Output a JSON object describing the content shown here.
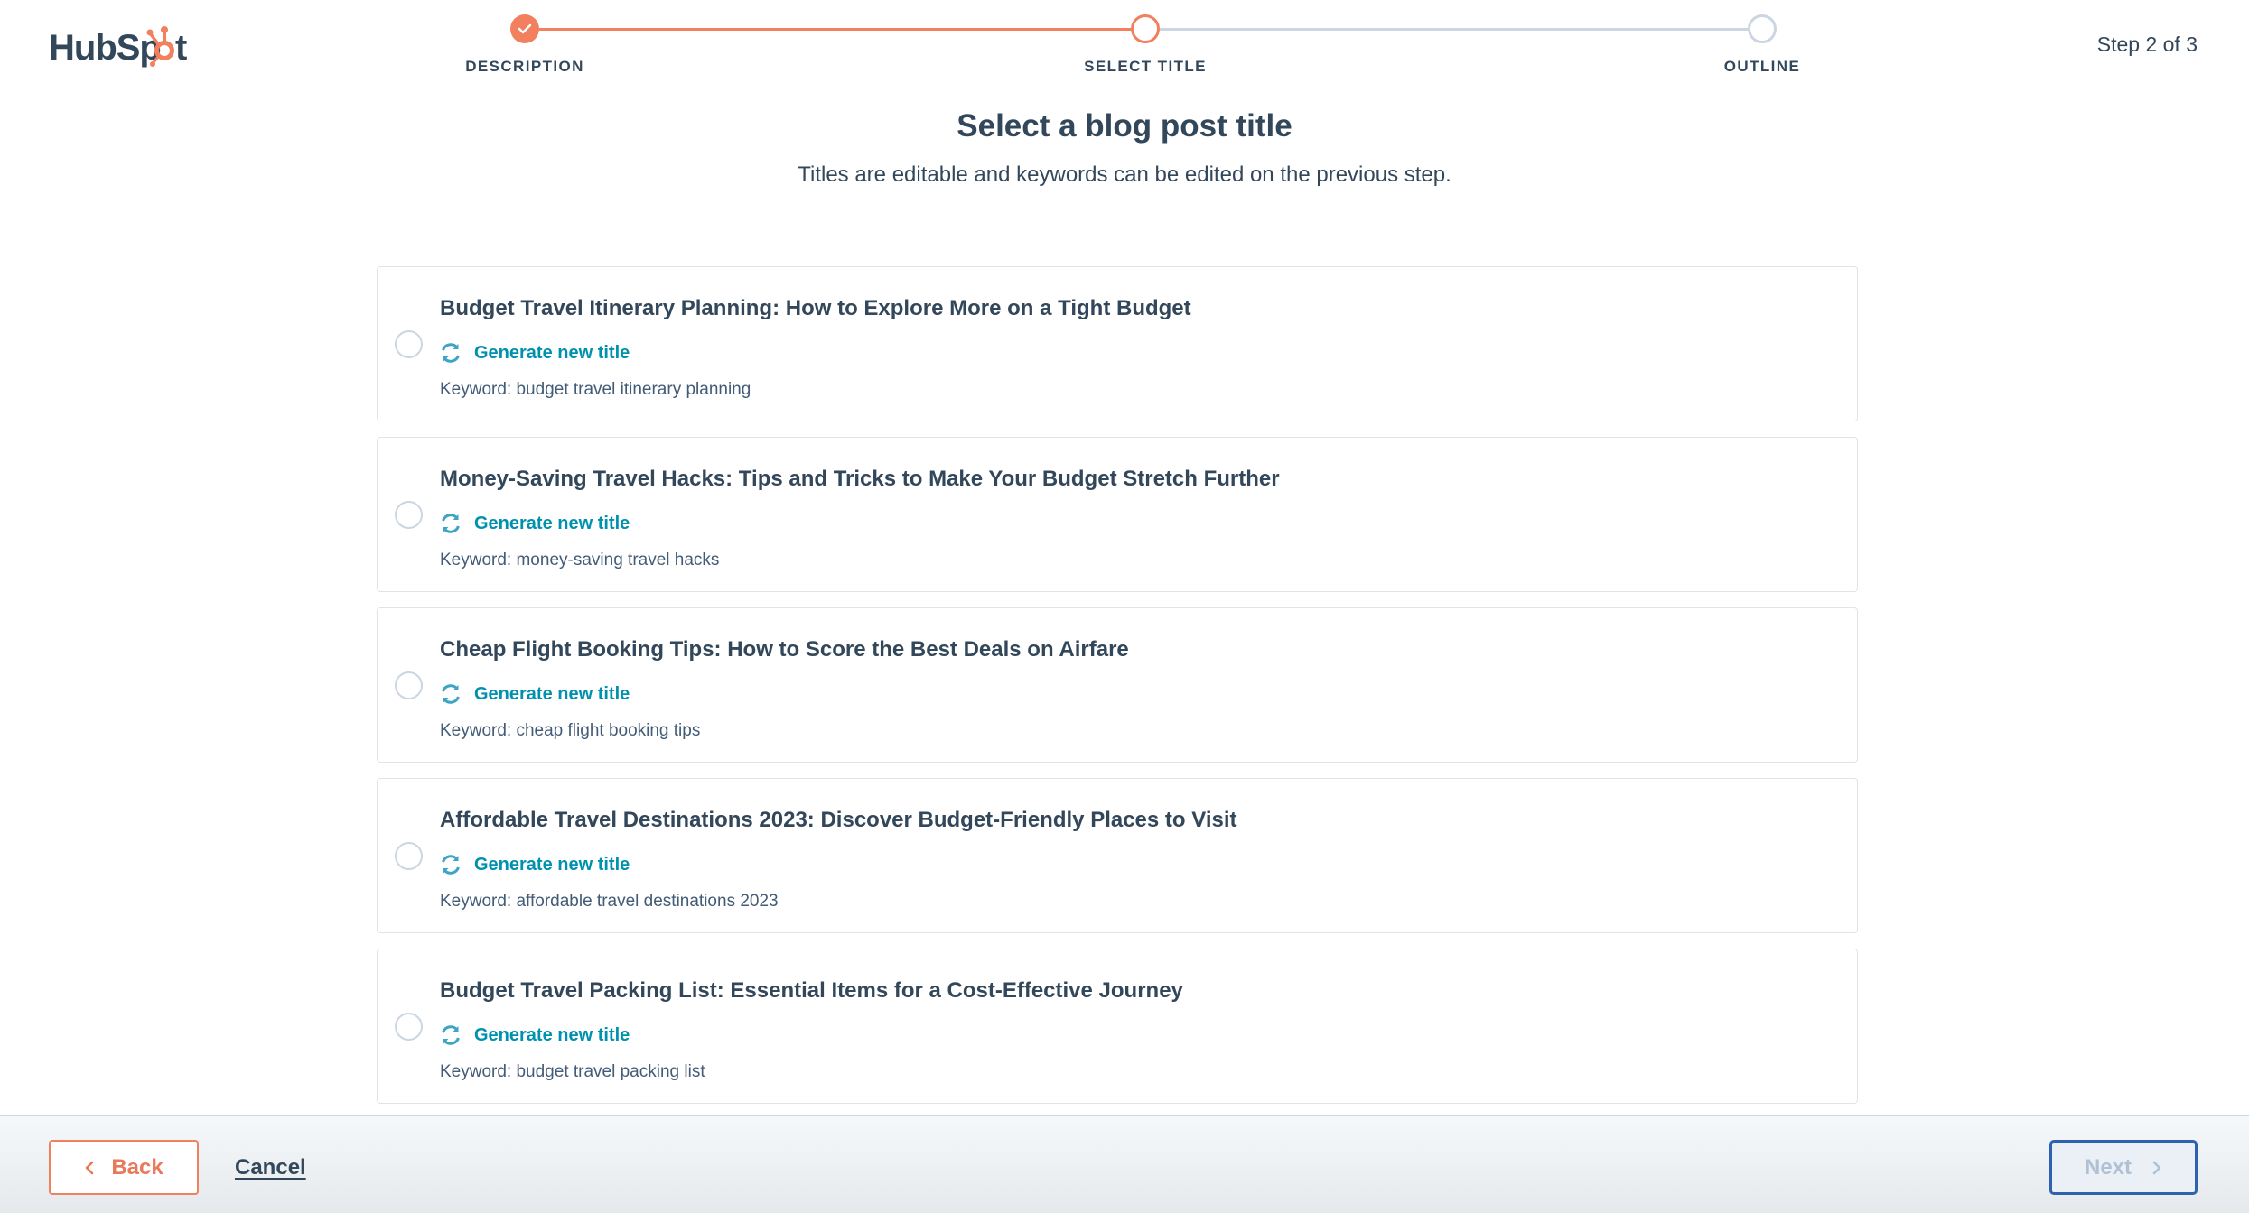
{
  "brand": {
    "name": "HubSpot",
    "primary_color": "#33475b",
    "accent_color": "#f2805e",
    "link_color": "#0091ae"
  },
  "stepper": {
    "steps": [
      {
        "label": "DESCRIPTION",
        "status": "complete",
        "icon": "check-icon"
      },
      {
        "label": "SELECT TITLE",
        "status": "active"
      },
      {
        "label": "OUTLINE",
        "status": "upcoming"
      }
    ],
    "step_count": "Step 2 of 3",
    "current_step": 2,
    "total_steps": 3
  },
  "main": {
    "heading": "Select a blog post title",
    "subheading": "Titles are editable and keywords can be edited on the previous step."
  },
  "titles": [
    {
      "title": "Budget Travel Itinerary Planning: How to Explore More on a Tight Budget",
      "regenerate_label": "Generate new title",
      "keyword": "Keyword: budget travel itinerary planning",
      "selected": false
    },
    {
      "title": "Money-Saving Travel Hacks: Tips and Tricks to Make Your Budget Stretch Further",
      "regenerate_label": "Generate new title",
      "keyword": "Keyword: money-saving travel hacks",
      "selected": false
    },
    {
      "title": "Cheap Flight Booking Tips: How to Score the Best Deals on Airfare",
      "regenerate_label": "Generate new title",
      "keyword": "Keyword: cheap flight booking tips",
      "selected": false
    },
    {
      "title": "Affordable Travel Destinations 2023: Discover Budget-Friendly Places to Visit",
      "regenerate_label": "Generate new title",
      "keyword": "Keyword: affordable travel destinations 2023",
      "selected": false
    },
    {
      "title": "Budget Travel Packing List: Essential Items for a Cost-Effective Journey",
      "regenerate_label": "Generate new title",
      "keyword": "Keyword: budget travel packing list",
      "selected": false
    }
  ],
  "footer": {
    "back_label": "Back",
    "cancel_label": "Cancel",
    "next_label": "Next",
    "next_disabled": true
  }
}
